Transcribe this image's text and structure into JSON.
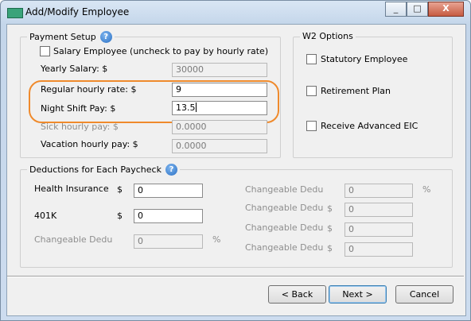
{
  "window": {
    "title": "Add/Modify Employee",
    "minimize": "_",
    "maximize": "□",
    "close": "X"
  },
  "payment": {
    "title": "Payment Setup",
    "salary_checkbox_label": "Salary Employee (uncheck to pay by hourly rate)",
    "yearly_label": "Yearly Salary: $",
    "yearly_value": "30000",
    "regular_label": "Regular hourly rate: $",
    "regular_value": "9",
    "night_label": "Night Shift Pay: $",
    "night_value": "13.5",
    "sick_label": "Sick hourly pay: $",
    "sick_value": "0.0000",
    "vacation_label": "Vacation hourly pay: $",
    "vacation_value": "0.0000"
  },
  "w2": {
    "title": "W2 Options",
    "statutory": "Statutory Employee",
    "retirement": "Retirement Plan",
    "eic": "Receive Advanced EIC"
  },
  "deductions": {
    "title": "Deductions for Each Paycheck",
    "health_label": "Health Insurance",
    "health_value": "0",
    "k401_label": "401K",
    "k401_value": "0",
    "dollar": "$",
    "percent": "%",
    "changeable_left_label": "Changeable Dedu",
    "changeable_left_value": "0",
    "changeable_right": [
      {
        "label": "Changeable Dedu",
        "value": "0",
        "unit": "%"
      },
      {
        "label": "Changeable Dedu",
        "value": "0",
        "unit": "$"
      },
      {
        "label": "Changeable Dedu",
        "value": "0",
        "unit": "$"
      },
      {
        "label": "Changeable Dedu",
        "value": "0",
        "unit": "$"
      }
    ]
  },
  "buttons": {
    "back": "< Back",
    "next": "Next >",
    "cancel": "Cancel"
  }
}
